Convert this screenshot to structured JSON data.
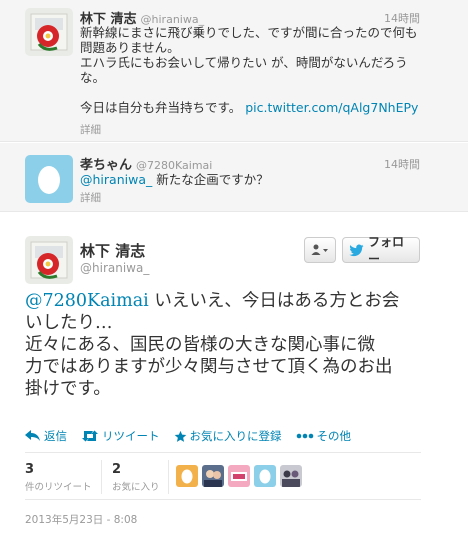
{
  "tweets": [
    {
      "fullname": "林下 清志",
      "handle": "@hiraniwa_",
      "time": "14時間",
      "lines": [
        "新幹線にまさに飛び乗りでした、ですが間に合ったので何も",
        "問題ありません。",
        "エハラ氏にもお会いして帰りたい が、時間がないんだろう",
        "な。",
        "",
        "今日は自分も弁当持ちです。"
      ],
      "link": "pic.twitter.com/qAlg7NhEPy",
      "detail": "詳細"
    },
    {
      "fullname": "孝ちゃん",
      "handle": "@7280Kaimai",
      "time": "14時間",
      "mention": "@hiraniwa_",
      "text": " 新たな企画ですか？",
      "detail": "詳細"
    }
  ],
  "main": {
    "fullname": "林下 清志",
    "handle": "@hiraniwa_",
    "follow_label": "フォロー",
    "mention": "@7280Kaimai",
    "lines": [
      " いえいえ、今日はある方とお会",
      "いしたり…",
      "近々にある、国民の皆様の大きな関心事に微",
      "力ではありますが少々関与させて頂く為のお出",
      "掛けです。"
    ],
    "actions": {
      "reply": "返信",
      "retweet": "リツイート",
      "favorite": "お気に入りに登録",
      "more": "その他"
    },
    "stats": {
      "retweets_count": "3",
      "retweets_label": "件のリツイート",
      "favorites_count": "2",
      "favorites_label": "お気に入り"
    },
    "timestamp": "2013年5月23日 - 8:08"
  },
  "icons": {
    "reply": "reply-arrow-icon",
    "retweet": "retweet-icon",
    "favorite": "star-icon",
    "more": "ellipsis-icon",
    "user": "user-dropdown-icon",
    "bird": "twitter-bird-icon"
  },
  "colors": {
    "link": "#0084b4",
    "muted": "#999999",
    "row_bg": "#f5f5f5"
  }
}
